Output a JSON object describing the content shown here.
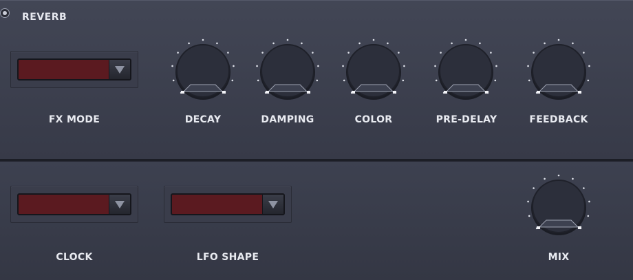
{
  "section": {
    "title": "REVERB"
  },
  "controls": {
    "fx_mode": {
      "label": "FX MODE",
      "value": ""
    },
    "clock": {
      "label": "CLOCK",
      "value": ""
    },
    "lfo_shape": {
      "label": "LFO SHAPE",
      "value": ""
    }
  },
  "knobs": [
    {
      "id": "decay",
      "label": "DECAY"
    },
    {
      "id": "damping",
      "label": "DAMPING"
    },
    {
      "id": "color",
      "label": "COLOR"
    },
    {
      "id": "pre_delay",
      "label": "PRE-DELAY"
    },
    {
      "id": "feedback",
      "label": "FEEDBACK"
    },
    {
      "id": "mix",
      "label": "MIX"
    }
  ],
  "colors": {
    "dropdown_fill": "#5b1a20",
    "knob_fill": "#2c2f3b",
    "tick": "#dfe2ea"
  }
}
